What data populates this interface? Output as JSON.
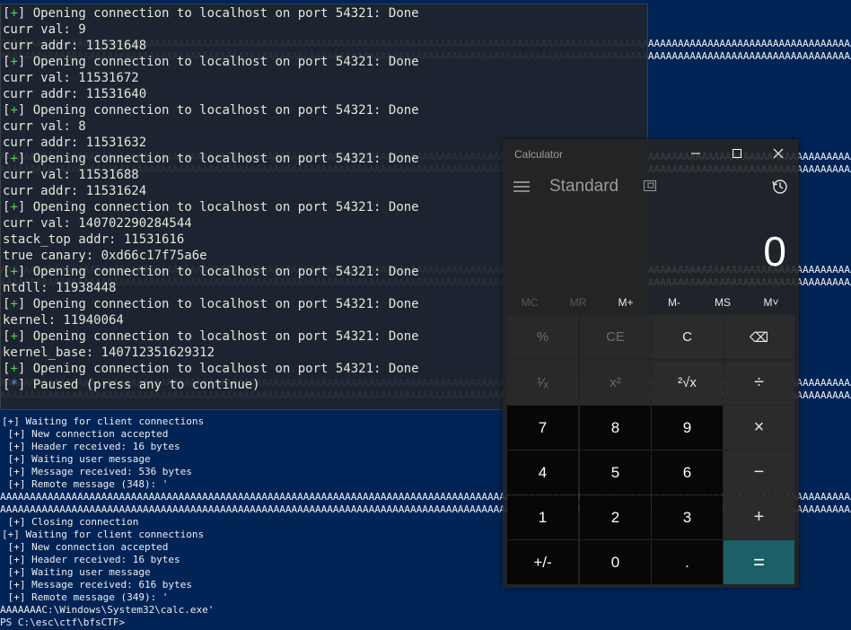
{
  "powershell": {
    "a_string": "AAAAAAAAAAAAAAAAAAAAAAAAAAAAAAAAAAAAAAAAAAAAAAAAAAAAAAAAAAAAAAAAAAAAAAAAAAAAAAAAAAAAAAAAAAAAAAAAAAAAAAAAAAAAAAAAAAAAAAAAAAAAAAAAAAAAAAAAAAAAAAAAAAAAAAAAAAAA",
    "lines": [
      "[+] Waiting for client connections",
      " [+] New connection accepted",
      " [+] Header received: 16 bytes",
      " [+] Waiting user message",
      " [+] Message received: 536 bytes",
      " [+] Remote message (348): '",
      "",
      "",
      " [+] Closing connection",
      "[+] Waiting for client connections",
      " [+] New connection accepted",
      " [+] Header received: 16 bytes",
      " [+] Waiting user message",
      " [+] Message received: 616 bytes",
      " [+] Remote message (349): '",
      "AAAAAAAC:\\Windows\\System32\\calc.exe'",
      "PS C:\\esc\\ctf\\bfsCTF>"
    ]
  },
  "terminal": {
    "lines": [
      {
        "tag": "+",
        "text": " Opening connection to localhost on port 54321: Done"
      },
      {
        "tag": "",
        "text": "curr val: 9"
      },
      {
        "tag": "",
        "text": "curr addr: 11531648"
      },
      {
        "tag": "+",
        "text": " Opening connection to localhost on port 54321: Done"
      },
      {
        "tag": "",
        "text": "curr val: 11531672"
      },
      {
        "tag": "",
        "text": "curr addr: 11531640"
      },
      {
        "tag": "+",
        "text": " Opening connection to localhost on port 54321: Done"
      },
      {
        "tag": "",
        "text": "curr val: 8"
      },
      {
        "tag": "",
        "text": "curr addr: 11531632"
      },
      {
        "tag": "+",
        "text": " Opening connection to localhost on port 54321: Done"
      },
      {
        "tag": "",
        "text": "curr val: 11531688"
      },
      {
        "tag": "",
        "text": "curr addr: 11531624"
      },
      {
        "tag": "+",
        "text": " Opening connection to localhost on port 54321: Done"
      },
      {
        "tag": "",
        "text": "curr val: 140702290284544"
      },
      {
        "tag": "",
        "text": "stack_top addr: 11531616"
      },
      {
        "tag": "",
        "text": "true canary: 0xd66c17f75a6e"
      },
      {
        "tag": "+",
        "text": " Opening connection to localhost on port 54321: Done"
      },
      {
        "tag": "",
        "text": "ntdll: 11938448"
      },
      {
        "tag": "+",
        "text": " Opening connection to localhost on port 54321: Done"
      },
      {
        "tag": "",
        "text": "kernel: 11940064"
      },
      {
        "tag": "+",
        "text": " Opening connection to localhost on port 54321: Done"
      },
      {
        "tag": "",
        "text": "kernel_base: 140712351629312"
      },
      {
        "tag": "+",
        "text": " Opening connection to localhost on port 54321: Done"
      },
      {
        "tag": "*",
        "text": " Paused (press any to continue)"
      }
    ]
  },
  "calculator": {
    "title": "Calculator",
    "mode": "Standard",
    "display": "0",
    "memory": [
      "MC",
      "MR",
      "M+",
      "M-",
      "MS",
      "M˅"
    ],
    "rows": [
      [
        {
          "label": "%",
          "kind": "g1"
        },
        {
          "label": "CE",
          "kind": "g1"
        },
        {
          "label": "C",
          "kind": "g2"
        },
        {
          "label": "⌫",
          "kind": "g2",
          "name": "backspace-button"
        }
      ],
      [
        {
          "label": "¹⁄ₓ",
          "kind": "g1",
          "name": "reciprocal-button"
        },
        {
          "label": "x²",
          "kind": "g1",
          "name": "square-button"
        },
        {
          "label": "²√x",
          "kind": "g2",
          "name": "sqrt-button"
        },
        {
          "label": "÷",
          "kind": "op",
          "name": "divide-button"
        }
      ],
      [
        {
          "label": "7",
          "kind": "num"
        },
        {
          "label": "8",
          "kind": "num"
        },
        {
          "label": "9",
          "kind": "num"
        },
        {
          "label": "×",
          "kind": "op",
          "name": "multiply-button"
        }
      ],
      [
        {
          "label": "4",
          "kind": "num"
        },
        {
          "label": "5",
          "kind": "num"
        },
        {
          "label": "6",
          "kind": "num"
        },
        {
          "label": "−",
          "kind": "op",
          "name": "minus-button"
        }
      ],
      [
        {
          "label": "1",
          "kind": "num"
        },
        {
          "label": "2",
          "kind": "num"
        },
        {
          "label": "3",
          "kind": "num"
        },
        {
          "label": "+",
          "kind": "op",
          "name": "plus-button"
        }
      ],
      [
        {
          "label": "+/-",
          "kind": "num",
          "name": "negate-button"
        },
        {
          "label": "0",
          "kind": "num"
        },
        {
          "label": ".",
          "kind": "num",
          "name": "decimal-button"
        },
        {
          "label": "=",
          "kind": "eq",
          "name": "equals-button"
        }
      ]
    ]
  }
}
